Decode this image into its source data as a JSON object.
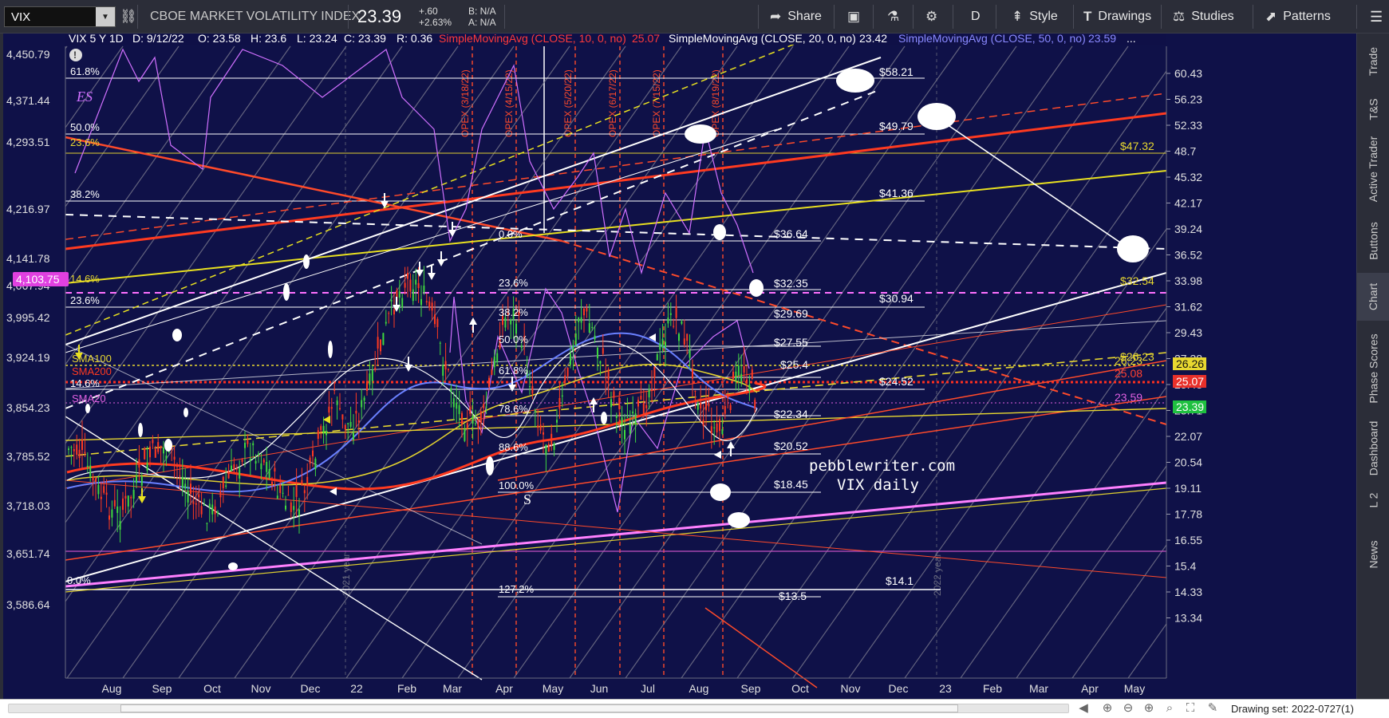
{
  "toolbar": {
    "symbol": "VIX",
    "title": "CBOE MARKET VOLATILITY INDEX",
    "last": "23.39",
    "change": "+.60",
    "change_pct": "+2.63%",
    "bid": "B: N/A",
    "ask": "A: N/A",
    "share": "Share",
    "period": "D",
    "style": "Style",
    "drawings": "Drawings",
    "studies": "Studies",
    "patterns": "Patterns"
  },
  "header": {
    "symbol_period": "VIX 5 Y 1D",
    "date": "D: 9/12/22",
    "open": "O: 23.58",
    "high": "H: 23.6",
    "low": "L: 23.24",
    "close": "C: 23.39",
    "range": "R: 0.36",
    "sma10_label": "SimpleMovingAvg (CLOSE, 10, 0, no)",
    "sma10_value": "25.07",
    "sma20_label": "SimpleMovingAvg (CLOSE, 20, 0, no)",
    "sma20_value": "23.42",
    "sma50_label": "SimpleMovingAvg (CLOSE, 50, 0, no)",
    "sma50_value": "23.59"
  },
  "left_axis": [
    "4,450.79",
    "4,371.44",
    "4,293.51",
    "4,216.97",
    "4,141.78",
    "4,067.94",
    "3,995.42",
    "3,924.19",
    "3,854.23",
    "3,785.52",
    "3,718.03",
    "3,651.74",
    "3,586.64"
  ],
  "left_axis_badge": "4,103.75",
  "right_axis": [
    "60.43",
    "56.23",
    "52.33",
    "48.7",
    "45.32",
    "42.17",
    "39.24",
    "36.52",
    "33.98",
    "31.62",
    "29.43",
    "27.38",
    "25.48",
    "23.71",
    "22.07",
    "20.54",
    "19.11",
    "17.78",
    "16.55",
    "15.4",
    "14.33",
    "13.34"
  ],
  "right_badges": {
    "yellow": "26.26",
    "red": "25.07",
    "green": "23.39",
    "yellow_label": "26.23",
    "red_labels": "25.08",
    "pink_labels": "23.59"
  },
  "x_axis": [
    "Aug",
    "Sep",
    "Oct",
    "Nov",
    "Dec",
    "22",
    "Feb",
    "Mar",
    "Apr",
    "May",
    "Jun",
    "Jul",
    "Aug",
    "Sep",
    "Oct",
    "Nov",
    "Dec",
    "23",
    "Feb",
    "Mar",
    "Apr",
    "May"
  ],
  "year_markers": [
    "2021 year",
    "2022 year"
  ],
  "opex_labels": [
    "OPEX (3/18/22)",
    "OPEX (4/15/22)",
    "OPEX (5/20/22)",
    "OPEX (6/17/22)",
    "OPEX (7/15/22)",
    "OPEX (8/19/22)"
  ],
  "fib_left": [
    "61.8%",
    "50.0%",
    "23.6%",
    "38.2%",
    "14.6%",
    "23.6%",
    "14.6%",
    "0.0%"
  ],
  "fib_mid": [
    "0.0%",
    "23.6%",
    "38.2%",
    "50.0%",
    "61.8%",
    "78.6%",
    "88.6%",
    "100.0%",
    "127.2%"
  ],
  "price_levels_mid": [
    "$36.64",
    "$32.35",
    "$29.69",
    "$27.55",
    "$25.4",
    "$22.34",
    "$20.52",
    "$18.45",
    "$13.5"
  ],
  "price_levels_right": [
    "$58.21",
    "$49.79",
    "$41.36",
    "$30.94",
    "$24.52",
    "$14.1"
  ],
  "price_levels_far": [
    "$47.32",
    "$32.54",
    "$26.23"
  ],
  "sma_labels": [
    "SMA100",
    "SMA200",
    "SMA20"
  ],
  "es_label": "ES",
  "s_label": "S",
  "watermark": [
    "pebblewriter.com",
    "VIX daily"
  ],
  "right_tabs": [
    "Trade",
    "T&S",
    "Active Trader",
    "Buttons",
    "Chart",
    "Phase Scores",
    "Dashboard",
    "L 2",
    "News"
  ],
  "status": {
    "drawing_set": "Drawing set: 2022-0727(1)"
  }
}
